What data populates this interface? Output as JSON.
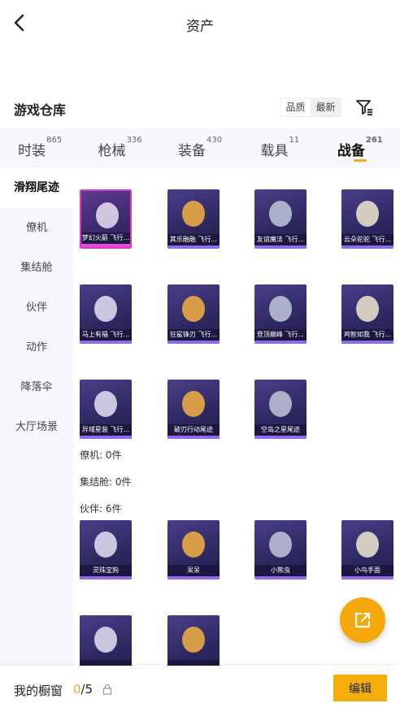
{
  "header": {
    "title": "资产"
  },
  "warehouse": {
    "title": "游戏仓库",
    "sort_options": [
      "品质",
      "最新"
    ],
    "active_sort": "最新"
  },
  "tabs": [
    {
      "label": "时装",
      "count": "865"
    },
    {
      "label": "枪械",
      "count": "336"
    },
    {
      "label": "装备",
      "count": "430"
    },
    {
      "label": "载具",
      "count": "11"
    },
    {
      "label": "战备",
      "count": "261",
      "active": true
    }
  ],
  "sidebar": {
    "items": [
      "滑翔尾迹",
      "僚机",
      "集结舱",
      "伙伴",
      "动作",
      "降落伞",
      "大厅场景"
    ],
    "active": "滑翔尾迹"
  },
  "trail_items": [
    {
      "name": "梦幻火箭 飞行...",
      "rarity": "pink"
    },
    {
      "name": "其乐融融 飞行...",
      "rarity": "purple"
    },
    {
      "name": "友谊魔法 飞行...",
      "rarity": "purple"
    },
    {
      "name": "云朵驼驼 飞行...",
      "rarity": "purple"
    },
    {
      "name": "马上有福 飞行...",
      "rarity": "purple"
    },
    {
      "name": "狂鲨锋刃 飞行...",
      "rarity": "purple"
    },
    {
      "name": "登顶巅峰 飞行...",
      "rarity": "purple"
    },
    {
      "name": "鸡智如我 飞行...",
      "rarity": "purple"
    },
    {
      "name": "异域星装 飞行...",
      "rarity": "purple"
    },
    {
      "name": "破刃行动尾迹",
      "rarity": "purple"
    },
    {
      "name": "空岛之星尾迹",
      "rarity": "purple"
    }
  ],
  "sections": {
    "wingman": "僚机: 0件",
    "pod": "集结舱: 0件",
    "partner": "伙伴: 6件"
  },
  "partner_items": [
    {
      "name": "灵珠宝狗"
    },
    {
      "name": "呆呆"
    },
    {
      "name": "小熊虫"
    },
    {
      "name": "小鸟手面"
    },
    {
      "name": ""
    },
    {
      "name": ""
    }
  ],
  "bottom": {
    "label": "我的橱窗",
    "current": "0",
    "separator": "/",
    "total": "5",
    "edit_label": "编辑"
  },
  "colors": {
    "accent": "#f5a623",
    "button": "#f5ad0c",
    "card": "#2d2860",
    "rare_border": "#d63ad0"
  }
}
